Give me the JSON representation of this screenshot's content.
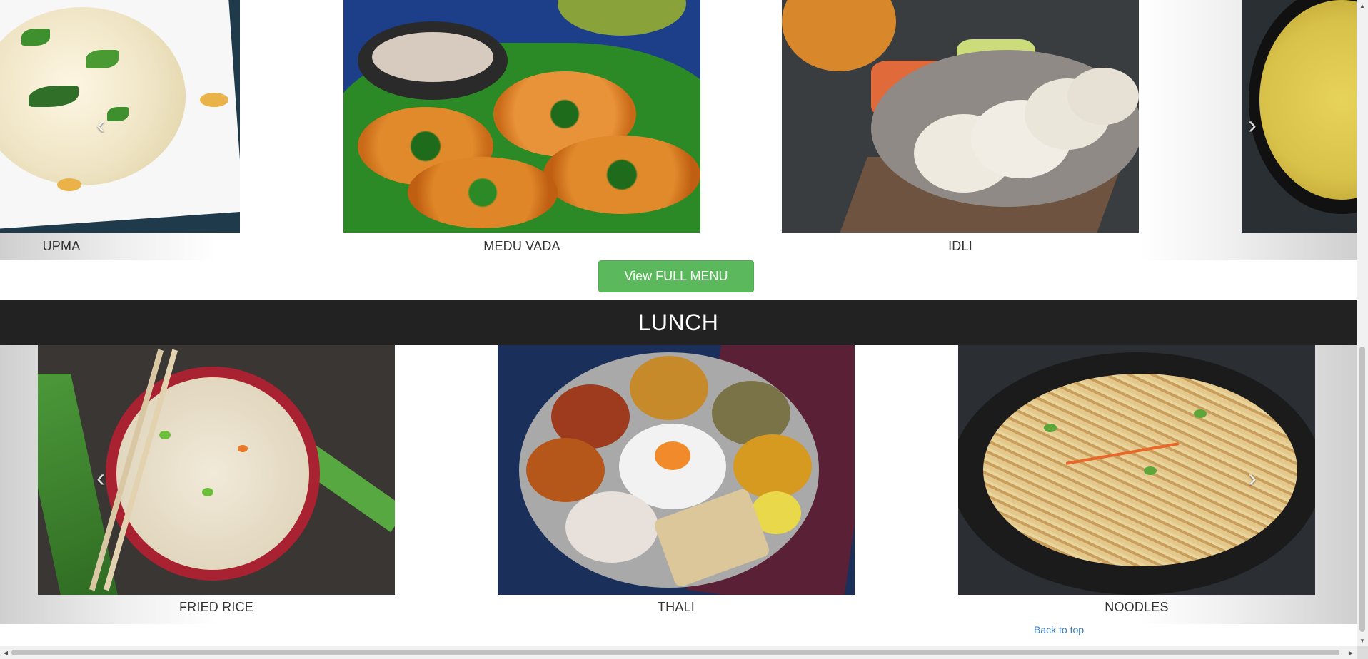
{
  "breakfast": {
    "items": [
      {
        "label": "UPMA"
      },
      {
        "label": "MEDU VADA"
      },
      {
        "label": "IDLI"
      }
    ],
    "prev_icon": "chevron-left-icon",
    "next_icon": "chevron-right-icon"
  },
  "menu_button": {
    "label": "View FULL MENU"
  },
  "lunch": {
    "title": "LUNCH",
    "items": [
      {
        "label": "FRIED RICE"
      },
      {
        "label": "THALI"
      },
      {
        "label": "NOODLES"
      }
    ],
    "prev_icon": "chevron-left-icon",
    "next_icon": "chevron-right-icon"
  },
  "footer": {
    "back_to_top": "Back to top"
  },
  "colors": {
    "section_bar": "#222222",
    "button": "#5cb85c",
    "link": "#337ab7"
  }
}
